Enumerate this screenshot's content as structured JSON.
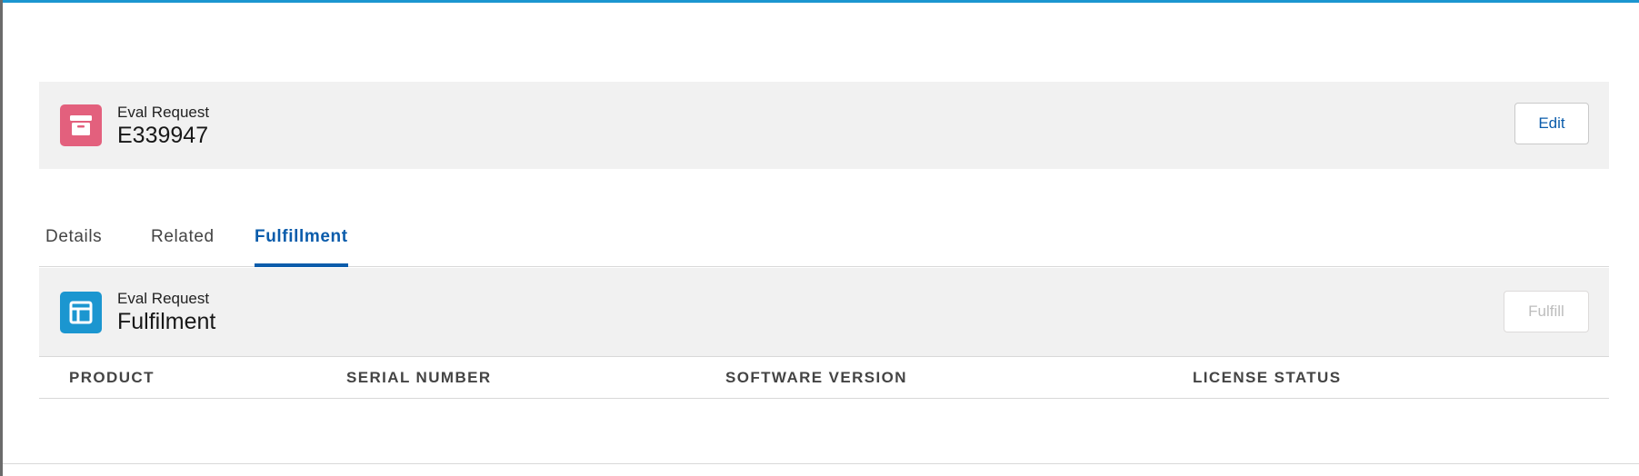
{
  "record": {
    "object_label": "Eval Request",
    "name": "E339947",
    "icon": "archive-box-icon",
    "icon_color": "#e3607d",
    "edit_label": "Edit"
  },
  "tabs": [
    {
      "label": "Details",
      "active": false
    },
    {
      "label": "Related",
      "active": false
    },
    {
      "label": "Fulfillment",
      "active": true
    }
  ],
  "fulfilment": {
    "object_label": "Eval Request",
    "title": "Fulfilment",
    "icon": "layout-panel-icon",
    "icon_color": "#1b96d0",
    "fulfill_label": "Fulfill",
    "fulfill_disabled": true,
    "columns": [
      "PRODUCT",
      "SERIAL NUMBER",
      "SOFTWARE VERSION",
      "LICENSE STATUS"
    ],
    "rows": []
  },
  "colors": {
    "accent": "#0b5cab",
    "top_bar": "#1b96d0",
    "panel_bg": "#f1f1f1"
  }
}
